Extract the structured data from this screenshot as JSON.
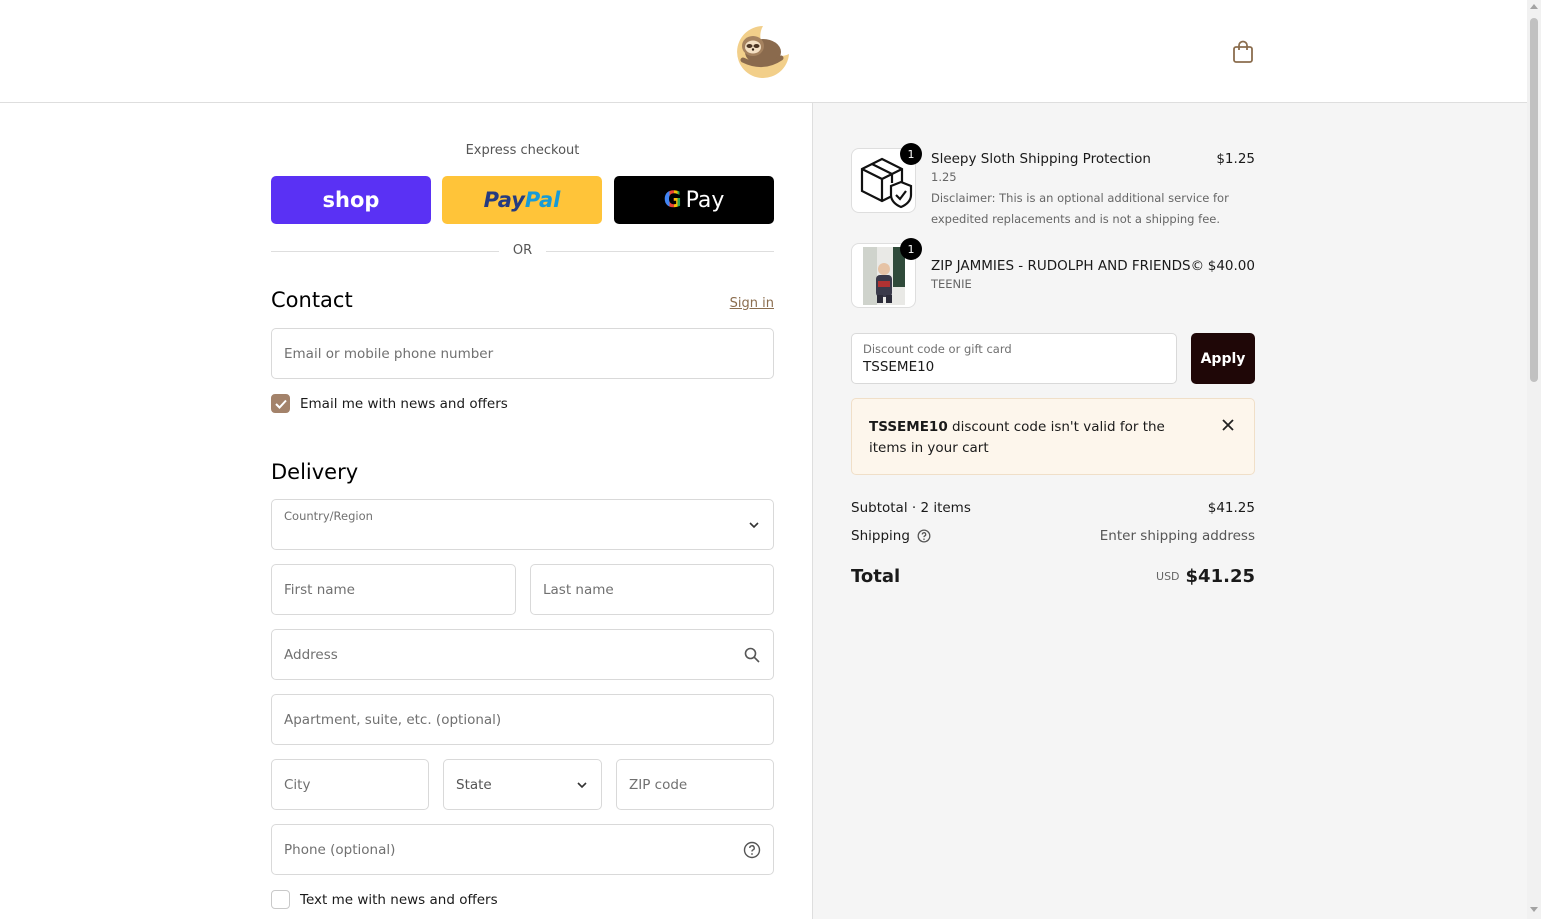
{
  "header": {
    "logo": "sleepy-sloth-logo",
    "cart_icon": "shopping-bag-icon"
  },
  "express": {
    "title": "Express checkout",
    "shop_label": "shop",
    "paypal_pay": "Pay",
    "paypal_pal": "Pal",
    "gpay_g": "G",
    "gpay_label": "Pay",
    "or_label": "OR"
  },
  "contact": {
    "title": "Contact",
    "sign_in": "Sign in",
    "email_placeholder": "Email or mobile phone number",
    "email_opt_in_label": "Email me with news and offers",
    "email_opt_in_checked": true
  },
  "delivery": {
    "title": "Delivery",
    "country_label": "Country/Region",
    "country_value": "",
    "first_name_placeholder": "First name",
    "last_name_placeholder": "Last name",
    "address_placeholder": "Address",
    "apartment_placeholder": "Apartment, suite, etc. (optional)",
    "city_placeholder": "City",
    "state_placeholder": "State",
    "zip_placeholder": "ZIP code",
    "phone_placeholder": "Phone (optional)",
    "sms_opt_in_label": "Text me with news and offers",
    "sms_opt_in_checked": false
  },
  "summary": {
    "items": [
      {
        "name": "Sleepy Sloth Shipping Protection",
        "variant": "1.25",
        "note_line1": "Disclaimer: This is an optional additional service for",
        "note_line2": "expedited replacements and is not a shipping fee.",
        "price": "$1.25",
        "quantity": "1",
        "icon": "package-shield-icon"
      },
      {
        "name": "ZIP JAMMIES - RUDOLPH AND FRIENDS©",
        "variant": "TEENIE",
        "price": "$40.00",
        "quantity": "1",
        "icon": "product-photo"
      }
    ],
    "discount_label": "Discount code or gift card",
    "discount_value": "TSSEME10",
    "apply_label": "Apply",
    "alert_code": "TSSEME10",
    "alert_message": "discount code isn't valid for the items in your cart",
    "subtotal_label": "Subtotal · 2 items",
    "subtotal_value": "$41.25",
    "shipping_label": "Shipping",
    "shipping_value": "Enter shipping address",
    "total_label": "Total",
    "total_currency": "USD",
    "total_value": "$41.25"
  },
  "colors": {
    "shop_purple": "#5a31f4",
    "paypal_yellow": "#ffc439",
    "gpay_black": "#000000",
    "accent_brown": "#a3826a",
    "apply_dark": "#1f0707",
    "alert_bg": "#fdf6ec"
  }
}
